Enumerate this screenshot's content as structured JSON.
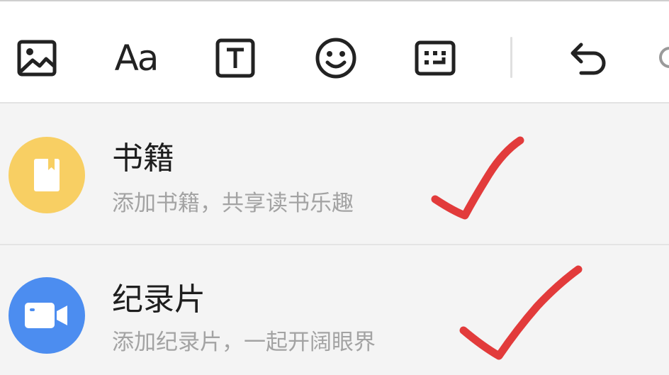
{
  "toolbar": {
    "tools": [
      {
        "name": "image",
        "icon": "image-icon"
      },
      {
        "name": "font",
        "label": "Aa",
        "icon": "font-size-icon"
      },
      {
        "name": "text-box",
        "icon": "text-box-icon"
      },
      {
        "name": "emoji",
        "icon": "emoji-icon"
      },
      {
        "name": "keyboard",
        "icon": "keyboard-icon"
      },
      {
        "name": "undo",
        "icon": "undo-icon"
      }
    ]
  },
  "list": {
    "items": [
      {
        "title": "书籍",
        "subtitle": "添加书籍，共享读书乐趣",
        "icon": "book-icon",
        "icon_color": "#f8cf63",
        "checked": true
      },
      {
        "title": "纪录片",
        "subtitle": "添加纪录片，一起开阔眼界",
        "icon": "video-camera-icon",
        "icon_color": "#4c8df0",
        "checked": true
      }
    ]
  },
  "colors": {
    "checkmark": "#e23b3b",
    "toolbar_bg": "#ffffff",
    "list_bg": "#f4f4f4"
  }
}
